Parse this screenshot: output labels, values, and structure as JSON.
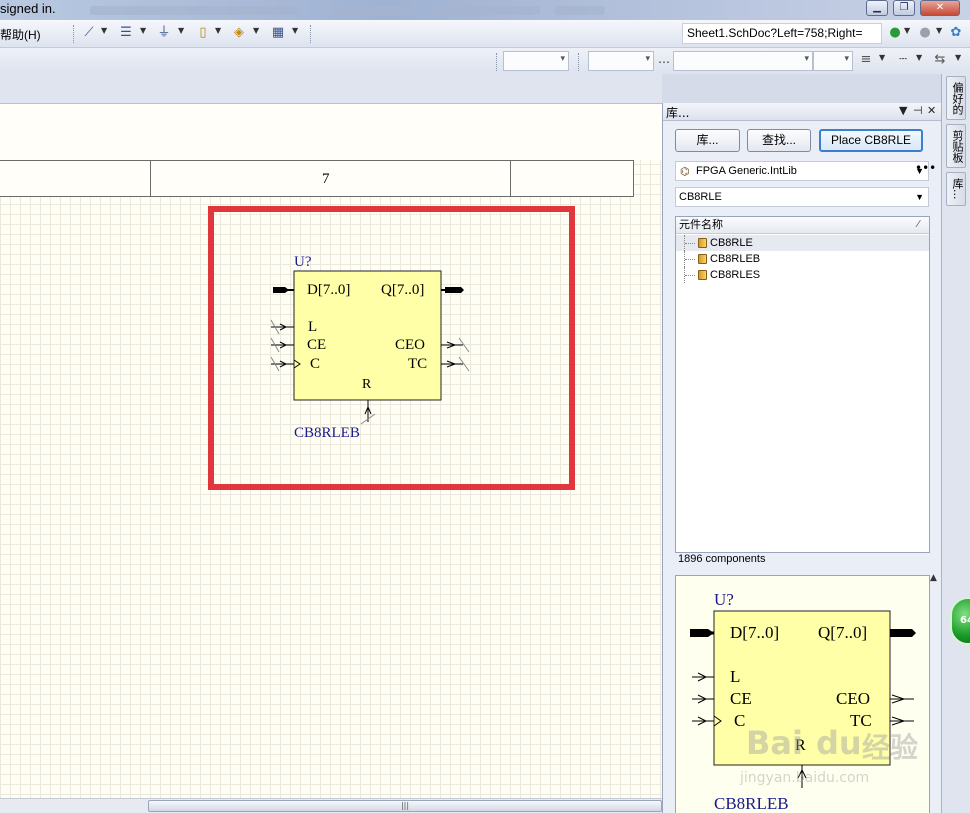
{
  "window": {
    "title": "signed in.",
    "buttons": {
      "minimize": "▁",
      "maximize": "❐",
      "close": "✕"
    }
  },
  "toolbar": {
    "help_menu": "帮助(H)",
    "address": "Sheet1.SchDoc?Left=758;Right=",
    "nav_icons": [
      "back-icon",
      "forward-icon",
      "tree-icon"
    ]
  },
  "sheet": {
    "zone_label": "7"
  },
  "component": {
    "designator": "U?",
    "name": "CB8RLEB",
    "pins_left": [
      "D[7..0]",
      "L",
      "CE",
      "C"
    ],
    "pins_right": [
      "Q[7..0]",
      "CEO",
      "TC"
    ],
    "pin_bottom": "R",
    "body_color": "#ffffa8",
    "designator_color": "#1a1b8c"
  },
  "library_panel": {
    "title": "库...",
    "buttons": {
      "library": "库...",
      "search": "查找...",
      "place": "Place CB8RLE"
    },
    "library_name": "FPGA Generic.IntLib",
    "filter_value": "CB8RLE",
    "column_header": "元件名称",
    "items": [
      "CB8RLE",
      "CB8RLEB",
      "CB8RLES"
    ],
    "selected_index": 0,
    "count_text": "1896 components",
    "preview": {
      "designator": "U?",
      "name": "CB8RLEB",
      "pins_left": [
        "D[7..0]",
        "L",
        "CE",
        "C"
      ],
      "pins_right": [
        "Q[7..0]",
        "CEO",
        "TC"
      ],
      "pin_bottom": "R"
    }
  },
  "side_tabs": [
    "偏好的",
    "剪贴板",
    "库..."
  ],
  "badge": {
    "text": "64"
  },
  "watermark": {
    "brand": "Bai",
    "brand2": "du",
    "cn": "经验",
    "url": "jingyan.baidu.com"
  },
  "colors": {
    "highlight_box": "#e3363c",
    "sheet_bg": "#fffef5",
    "accent_button": "#3c7fd0"
  }
}
